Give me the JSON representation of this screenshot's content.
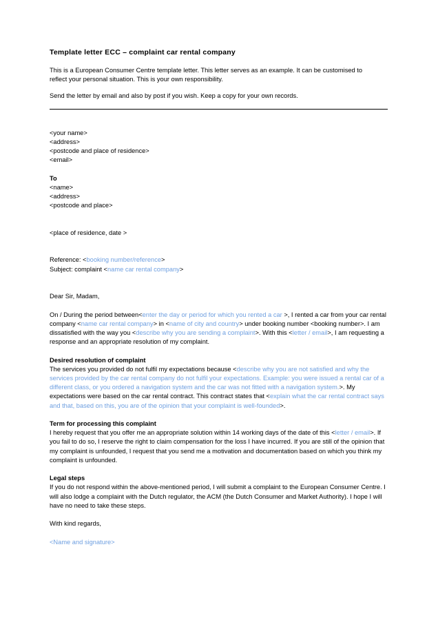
{
  "document": {
    "title": "Template letter ECC – complaint car rental company",
    "intro_paragraphs": [
      "This is a European Consumer Centre template letter. This letter serves as an example. It can be customised to reflect your personal situation. This is your own responsibility.",
      "Send the letter by email and also by post if you wish. Keep a copy for your own records."
    ],
    "sender_block": [
      "<your name>",
      "<address>",
      "<postcode and place of residence>",
      "<email>"
    ],
    "recipient_label": "To",
    "recipient_block": [
      "<name>",
      "<address>",
      "<postcode and place>"
    ],
    "place_date_line": "<place of residence, date >",
    "reference_line": {
      "label": "Reference: <",
      "placeholder": "booking number/reference",
      "tail": ">"
    },
    "subject_line": {
      "label": "Subject: complaint <",
      "placeholder": "name car rental company",
      "tail": ">"
    },
    "salutation": "Dear Sir, Madam,",
    "opening_paragraph": {
      "part1": "On / During the period between<",
      "ph1": "enter the day or period for which you rented a car ",
      "part2": ">, I rented a car from your car rental company <",
      "ph2": "name car rental company",
      "part3": "> in <",
      "ph3": "name of city and country",
      "part4": "> under booking number <booking number>. I am dissatisfied with the way you <",
      "ph4": "describe why you are sending a complaint",
      "part5": ">. With this <",
      "ph5": "letter / email",
      "part6": ">, I am requesting a response and an appropriate resolution of my complaint."
    },
    "section_desired": {
      "heading": "Desired resolution of complaint",
      "part1": "The services you provided do not fulfil my expectations because <",
      "ph1": "describe why you are not satisfied and why the services provided by the car rental company do not fulfil your expectations. Example: you were issued a rental car of a different class, or you ordered a navigation system and the car was not fitted with a navigation system.",
      "part2": ">. My expectations were based on the car rental contract. This contract states that <",
      "ph2": "explain what the car rental contract says and that, based on this, you are of the opinion that your complaint is well-founded",
      "part3": ">."
    },
    "section_term": {
      "heading": "Term for processing this complaint",
      "part1": "I hereby request that you offer me an appropriate solution within 14 working days of the date of this <",
      "ph1": "letter / email",
      "part2": ">. If you fail to do so, I reserve the right to claim compensation for the loss I have incurred. If you are still of the opinion that my complaint is unfounded, I request that you send me a motivation and documentation based on which you think my complaint is unfounded."
    },
    "section_legal": {
      "heading": "Legal steps",
      "body": "If you do not respond within the above-mentioned period, I will submit a complaint to the European Consumer Centre. I will also lodge a complaint with the Dutch regulator, the ACM (the Dutch Consumer and Market Authority). I hope I will have no need to take these steps."
    },
    "closing": "With kind regards,",
    "signature_placeholder": "<Name and signature>"
  },
  "colors": {
    "placeholder_blue": "#6e9fe0",
    "text_black": "#000000",
    "background": "#ffffff"
  }
}
